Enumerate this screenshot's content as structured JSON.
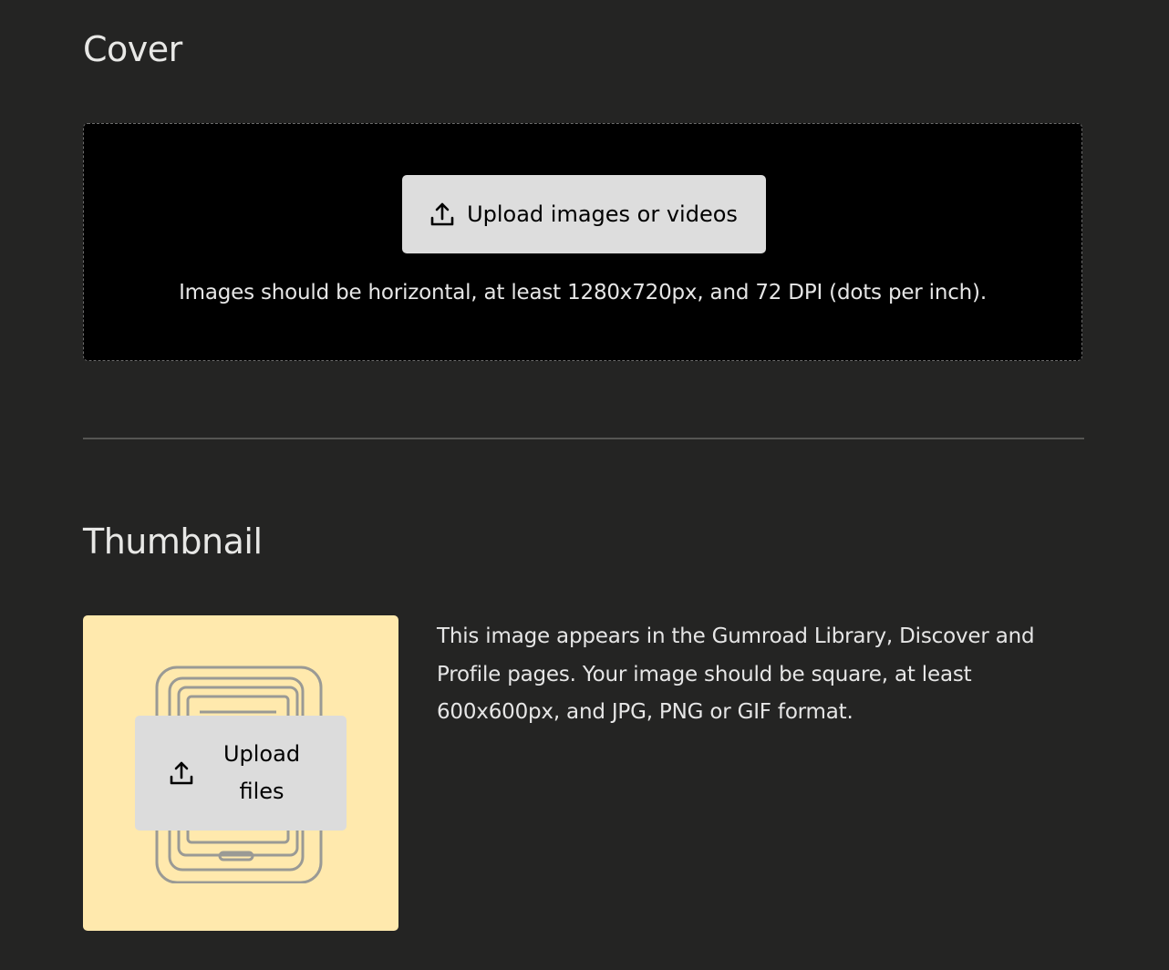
{
  "cover": {
    "title": "Cover",
    "upload_button_label": "Upload images or videos",
    "upload_icon": "upload-icon",
    "hint": "Images should be horizontal, at least 1280x720px, and 72 DPI (dots per inch)."
  },
  "thumbnail": {
    "title": "Thumbnail",
    "upload_button_label": "Upload files",
    "upload_icon": "upload-icon",
    "placeholder_icon": "tablet-stack-icon",
    "description": "This image appears in the Gumroad Library, Discover and Profile pages. Your image should be square, at least 600x600px, and JPG, PNG or GIF format."
  },
  "colors": {
    "background": "#242423",
    "dropzone_background": "#000000",
    "button_background": "#dddddd",
    "thumbnail_background": "#ffe9ad"
  }
}
